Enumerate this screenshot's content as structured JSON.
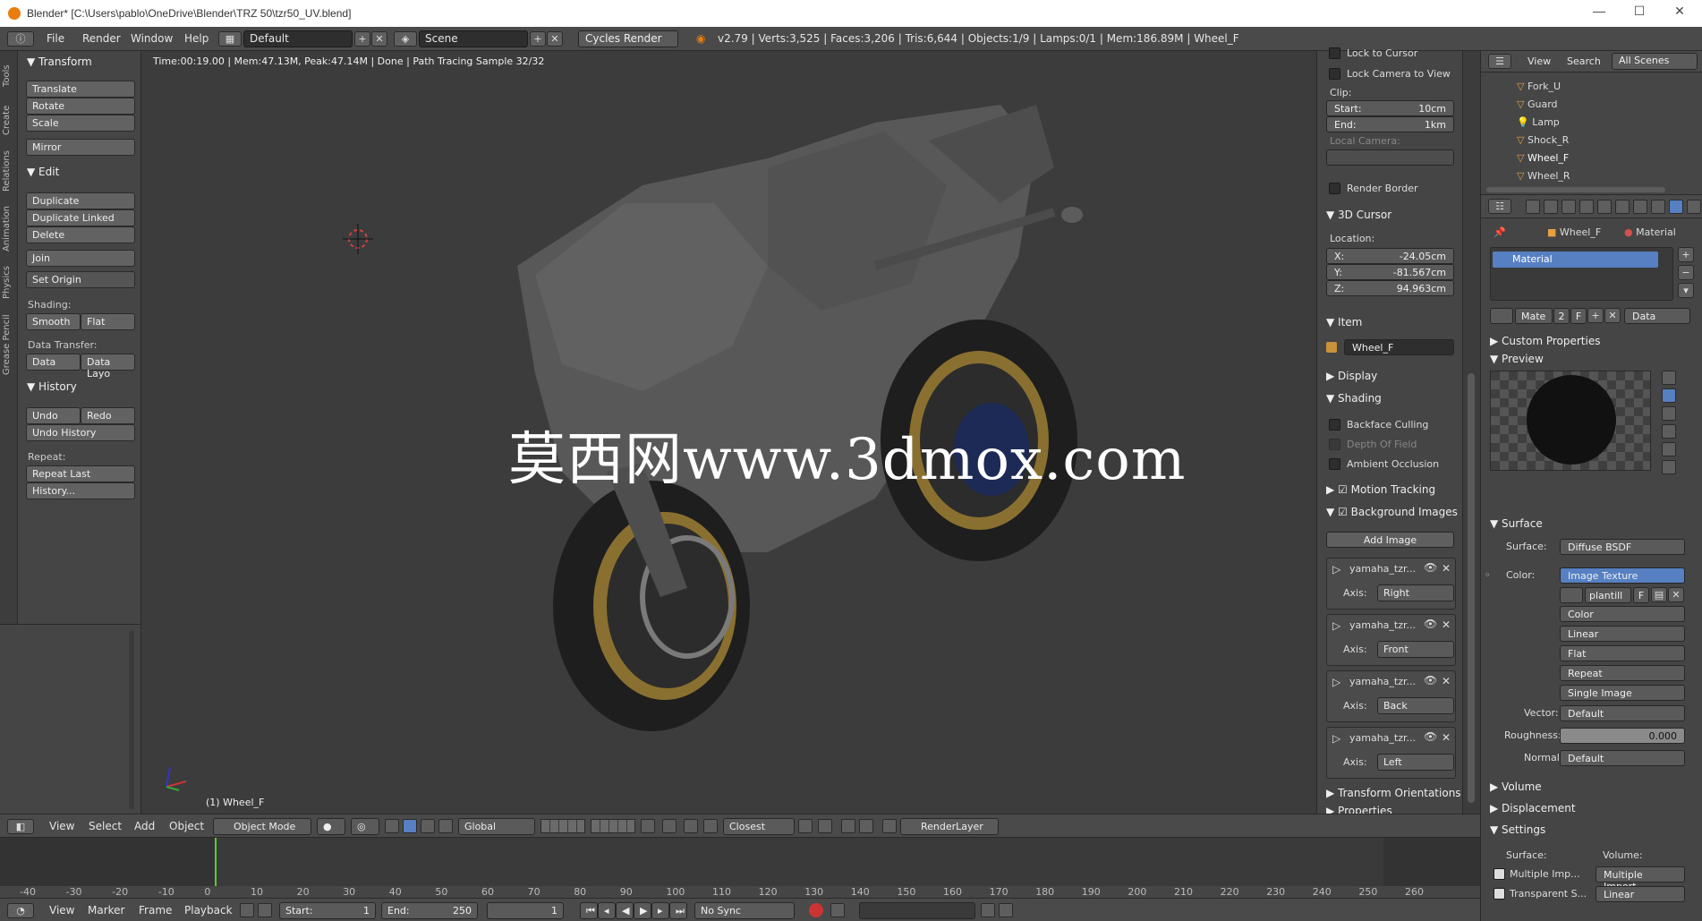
{
  "window": {
    "title": "Blender* [C:\\Users\\pablo\\OneDrive\\Blender\\TRZ 50\\tzr50_UV.blend]",
    "minimize": "—",
    "maximize": "☐",
    "close": "✕"
  },
  "topbar": {
    "menus": [
      "File",
      "Render",
      "Window",
      "Help"
    ],
    "layout": "Default",
    "scene": "Scene",
    "engine": "Cycles Render",
    "stats": "v2.79 | Verts:3,525 | Faces:3,206 | Tris:6,644 | Objects:1/9 | Lamps:0/1 | Mem:186.89M | Wheel_F"
  },
  "tool_tabs": [
    "Tools",
    "Create",
    "Relations",
    "Animation",
    "Physics",
    "Grease Pencil"
  ],
  "toolshelf": {
    "transform_header": "Transform",
    "transform_buttons": [
      "Translate",
      "Rotate",
      "Scale",
      "Mirror"
    ],
    "edit_header": "Edit",
    "edit_buttons": [
      "Duplicate",
      "Duplicate Linked",
      "Delete",
      "Join",
      "Set Origin"
    ],
    "shading_label": "Shading:",
    "shading_buttons": [
      "Smooth",
      "Flat"
    ],
    "data_transfer_label": "Data Transfer:",
    "data_transfer_buttons": [
      "Data",
      "Data Layo"
    ],
    "history_header": "History",
    "undo": "Undo",
    "redo": "Redo",
    "undo_history": "Undo History",
    "repeat_label": "Repeat:",
    "repeat_last": "Repeat Last",
    "history_btn": "History..."
  },
  "viewport": {
    "status": "Time:00:19.00 | Mem:47.13M, Peak:47.14M | Done | Path Tracing Sample 32/32",
    "object_label": "(1) Wheel_F",
    "watermark": "莫西网www.3dmox.com"
  },
  "npanel": {
    "lock_to_cursor": "Lock to Cursor",
    "lock_camera": "Lock Camera to View",
    "clip_label": "Clip:",
    "clip_start_k": "Start:",
    "clip_start_v": "10cm",
    "clip_end_k": "End:",
    "clip_end_v": "1km",
    "local_camera": "Local Camera:",
    "render_border": "Render Border",
    "cursor_header": "3D Cursor",
    "location_label": "Location:",
    "x_k": "X:",
    "x_v": "-24.05cm",
    "y_k": "Y:",
    "y_v": "-81.567cm",
    "z_k": "Z:",
    "z_v": "94.963cm",
    "item_header": "Item",
    "item_name": "Wheel_F",
    "display_header": "Display",
    "shading_header": "Shading",
    "backface": "Backface Culling",
    "dof": "Depth Of Field",
    "ao": "Ambient Occlusion",
    "motion_tracking": "Motion Tracking",
    "bg_images": "Background Images",
    "add_image": "Add Image",
    "bg_items": [
      {
        "name": "yamaha_tzr...",
        "axis_label": "Axis:",
        "axis": "Right"
      },
      {
        "name": "yamaha_tzr...",
        "axis_label": "Axis:",
        "axis": "Front"
      },
      {
        "name": "yamaha_tzr...",
        "axis_label": "Axis:",
        "axis": "Back"
      },
      {
        "name": "yamaha_tzr...",
        "axis_label": "Axis:",
        "axis": "Left"
      }
    ],
    "transform_orient": "Transform Orientations",
    "properties": "Properties"
  },
  "outliner": {
    "view": "View",
    "search": "Search",
    "all_scenes": "All Scenes",
    "items": [
      "Fork_U",
      "Guard",
      "Lamp",
      "Shock_R",
      "Wheel_F",
      "Wheel_R"
    ]
  },
  "props": {
    "breadcrumb_obj": "Wheel_F",
    "breadcrumb_mat": "Material",
    "slot": "Material",
    "mat_name": "Mate",
    "users": "2",
    "fake": "F",
    "link": "Data",
    "custom_props": "Custom Properties",
    "preview": "Preview",
    "surface_header": "Surface",
    "surface_label": "Surface:",
    "surface_value": "Diffuse BSDF",
    "color_label": "Color:",
    "color_value": "Image Texture",
    "image_name": "plantill",
    "image_f": "F",
    "opts": [
      "Color",
      "Linear",
      "Flat",
      "Repeat",
      "Single Image"
    ],
    "vector_label": "Vector:",
    "vector_value": "Default",
    "roughness_label": "Roughness:",
    "roughness_value": "0.000",
    "normal_label": "Normal:",
    "normal_value": "Default",
    "volume": "Volume",
    "displacement": "Displacement",
    "settings": "Settings",
    "set_surface": "Surface:",
    "set_volume": "Volume:",
    "multiple_imp": "Multiple Imp...",
    "multiple_import": "Multiple Import...",
    "transparent": "Transparent S...",
    "linear": "Linear"
  },
  "vheader": {
    "menus": [
      "View",
      "Select",
      "Add",
      "Object"
    ],
    "mode": "Object Mode",
    "orientation": "Global",
    "snap": "Closest",
    "renderlayer": "RenderLayer"
  },
  "timeline": {
    "ticks": [
      "-40",
      "-30",
      "-20",
      "-10",
      "0",
      "10",
      "20",
      "30",
      "40",
      "50",
      "60",
      "70",
      "80",
      "90",
      "100",
      "110",
      "120",
      "130",
      "140",
      "150",
      "160",
      "170",
      "180",
      "190",
      "200",
      "210",
      "220",
      "230",
      "240",
      "250",
      "260"
    ]
  },
  "tlheader": {
    "menus": [
      "View",
      "Marker",
      "Frame",
      "Playback"
    ],
    "start": "Start:",
    "start_v": "1",
    "end": "End:",
    "end_v": "250",
    "current": "1",
    "sync": "No Sync"
  }
}
